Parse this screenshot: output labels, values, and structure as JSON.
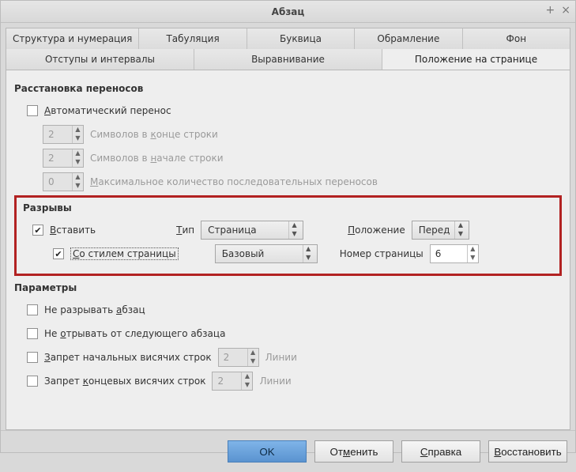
{
  "window": {
    "title": "Абзац"
  },
  "tabs_top": [
    {
      "label": "Структура и нумерация"
    },
    {
      "label": "Табуляция"
    },
    {
      "label": "Буквица"
    },
    {
      "label": "Обрамление"
    },
    {
      "label": "Фон"
    }
  ],
  "tabs_bottom": [
    {
      "label": "Отступы и интервалы"
    },
    {
      "label": "Выравнивание"
    },
    {
      "label": "Положение на странице"
    }
  ],
  "hyphen": {
    "section": "Расстановка переносов",
    "auto": "Автоматический перенос",
    "chars_end_val": "2",
    "chars_end_lbl": "Символов в конце строки",
    "chars_start_val": "2",
    "chars_start_lbl": "Символов в начале строки",
    "max_val": "0",
    "max_lbl": "Максимальное количество последовательных переносов"
  },
  "breaks": {
    "section": "Разрывы",
    "insert": "Вставить",
    "type_lbl": "Тип",
    "type_val": "Страница",
    "pos_lbl": "Положение",
    "pos_val": "Перед",
    "with_style": "Со стилем страницы",
    "style_val": "Базовый",
    "pagenum_lbl": "Номер страницы",
    "pagenum_val": "6"
  },
  "options": {
    "section": "Параметры",
    "no_split": "Не разрывать абзац",
    "keep_next": "Не отрывать от следующего абзаца",
    "orphans": "Запрет начальных висячих строк",
    "orphans_val": "2",
    "widows": "Запрет концевых висячих строк",
    "widows_val": "2",
    "lines": "Линии"
  },
  "buttons": {
    "ok": "OK",
    "cancel": "Отменить",
    "help": "Справка",
    "reset": "Восстановить"
  },
  "underline_map": {}
}
